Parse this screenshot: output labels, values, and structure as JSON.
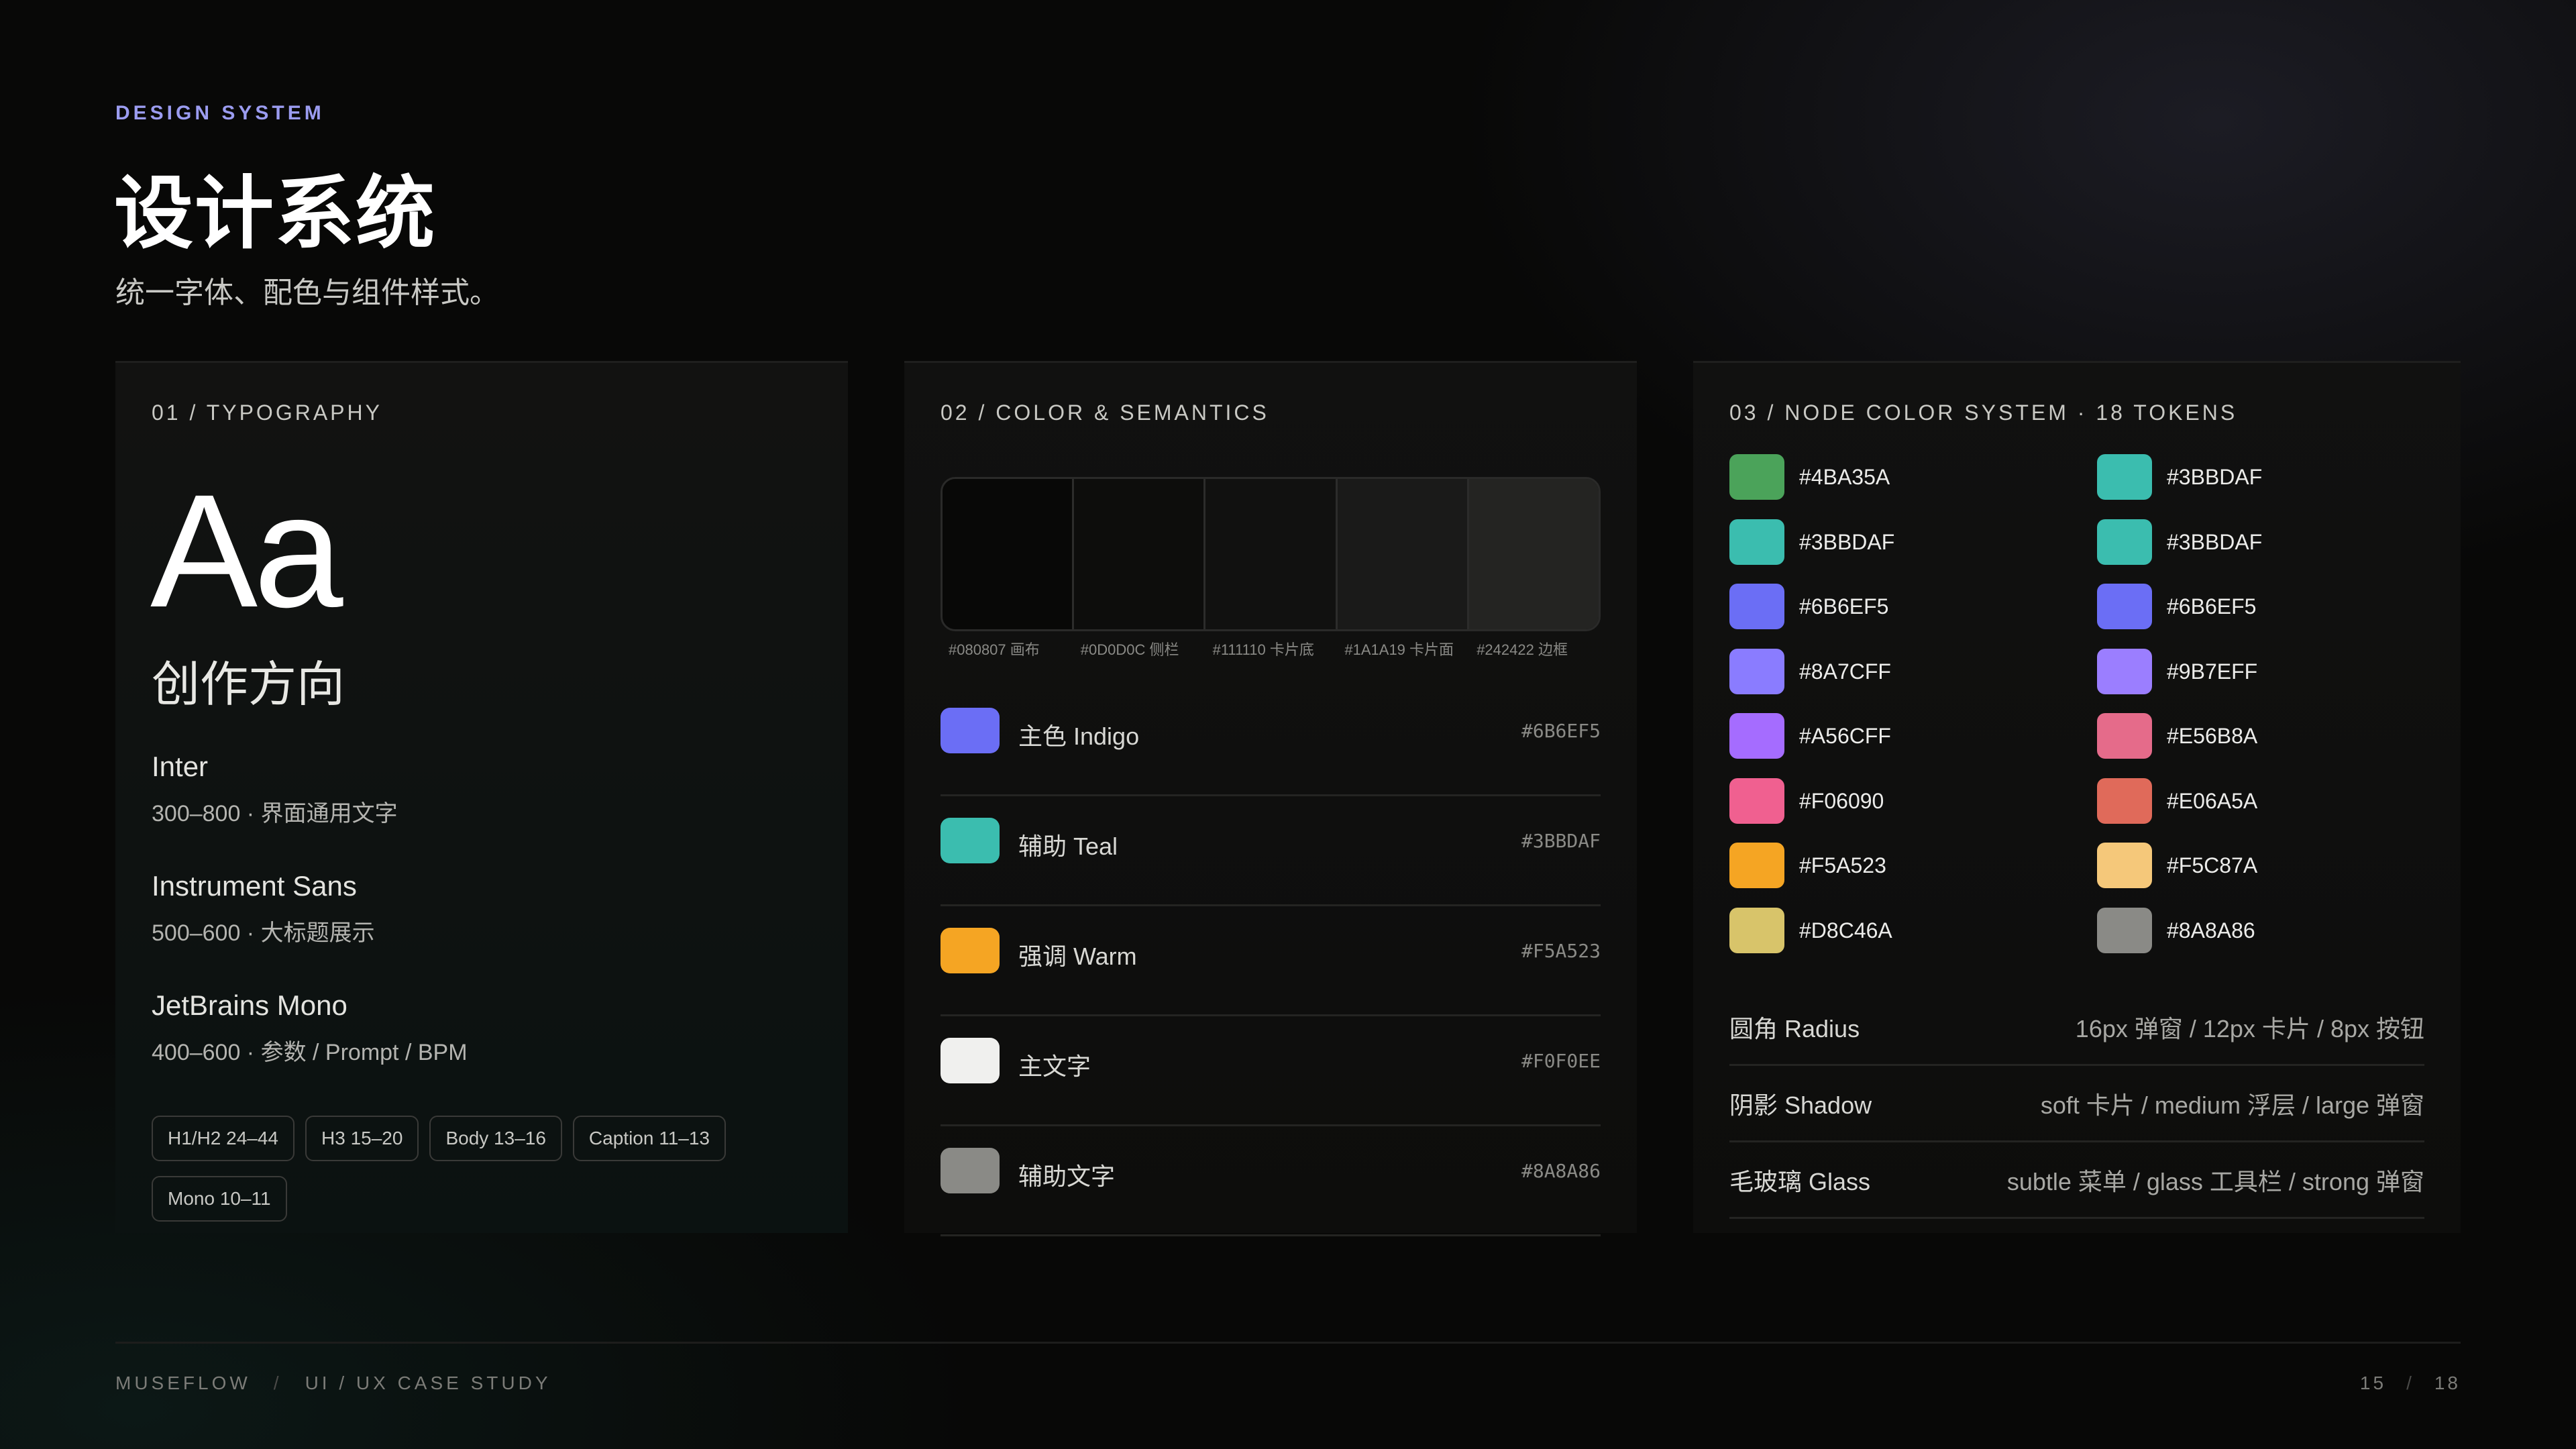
{
  "header": {
    "eyebrow": "DESIGN SYSTEM",
    "title": "设计系统",
    "subtitle": "统一字体、配色与组件样式。"
  },
  "typography": {
    "label": "01 / TYPOGRAPHY",
    "sample_latin": "Aa",
    "sample_cn": "创作方向",
    "fonts": [
      {
        "name": "Inter",
        "desc": "300–800 · 界面通用文字"
      },
      {
        "name": "Instrument Sans",
        "desc": "500–600 · 大标题展示"
      },
      {
        "name": "JetBrains Mono",
        "desc": "400–600 · 参数 / Prompt / BPM"
      }
    ],
    "chips": [
      "H1/H2 24–44",
      "H3 15–20",
      "Body 13–16",
      "Caption 11–13",
      "Mono 10–11"
    ]
  },
  "color": {
    "label": "02 / COLOR & SEMANTICS",
    "strip": [
      {
        "hex": "#080807",
        "label": "#080807 画布"
      },
      {
        "hex": "#0D0D0C",
        "label": "#0D0D0C 侧栏"
      },
      {
        "hex": "#111110",
        "label": "#111110 卡片底"
      },
      {
        "hex": "#1A1A19",
        "label": "#1A1A19 卡片面"
      },
      {
        "hex": "#242422",
        "label": "#242422 边框"
      }
    ],
    "semantics": [
      {
        "name": "主色 Indigo",
        "hex": "#6B6EF5"
      },
      {
        "name": "辅助 Teal",
        "hex": "#3BBDAF"
      },
      {
        "name": "强调 Warm",
        "hex": "#F5A523"
      },
      {
        "name": "主文字",
        "hex": "#F0F0EE"
      },
      {
        "name": "辅助文字",
        "hex": "#8A8A86"
      }
    ]
  },
  "nodes": {
    "label": "03 / NODE COLOR SYSTEM · 18 TOKENS",
    "tokens_left": [
      "#4BA35A",
      "#3BBDAF",
      "#6B6EF5",
      "#8A7CFF",
      "#A56CFF",
      "#F06090",
      "#F5A523",
      "#D8C46A"
    ],
    "tokens_right": [
      "#3BBDAF",
      "#3BBDAF",
      "#6B6EF5",
      "#9B7EFF",
      "#E56B8A",
      "#E06A5A",
      "#F5C87A",
      "#8A8A86"
    ],
    "specs": [
      {
        "name": "圆角 Radius",
        "value": "16px 弹窗 / 12px 卡片 / 8px 按钮"
      },
      {
        "name": "阴影 Shadow",
        "value": "soft 卡片 / medium 浮层 / large 弹窗"
      },
      {
        "name": "毛玻璃 Glass",
        "value": "subtle 菜单 / glass 工具栏 / strong 弹窗"
      }
    ]
  },
  "footer": {
    "brand": "MUSEFLOW",
    "sep": "/",
    "section": "UI / UX CASE STUDY",
    "page": "15",
    "total": "18"
  }
}
